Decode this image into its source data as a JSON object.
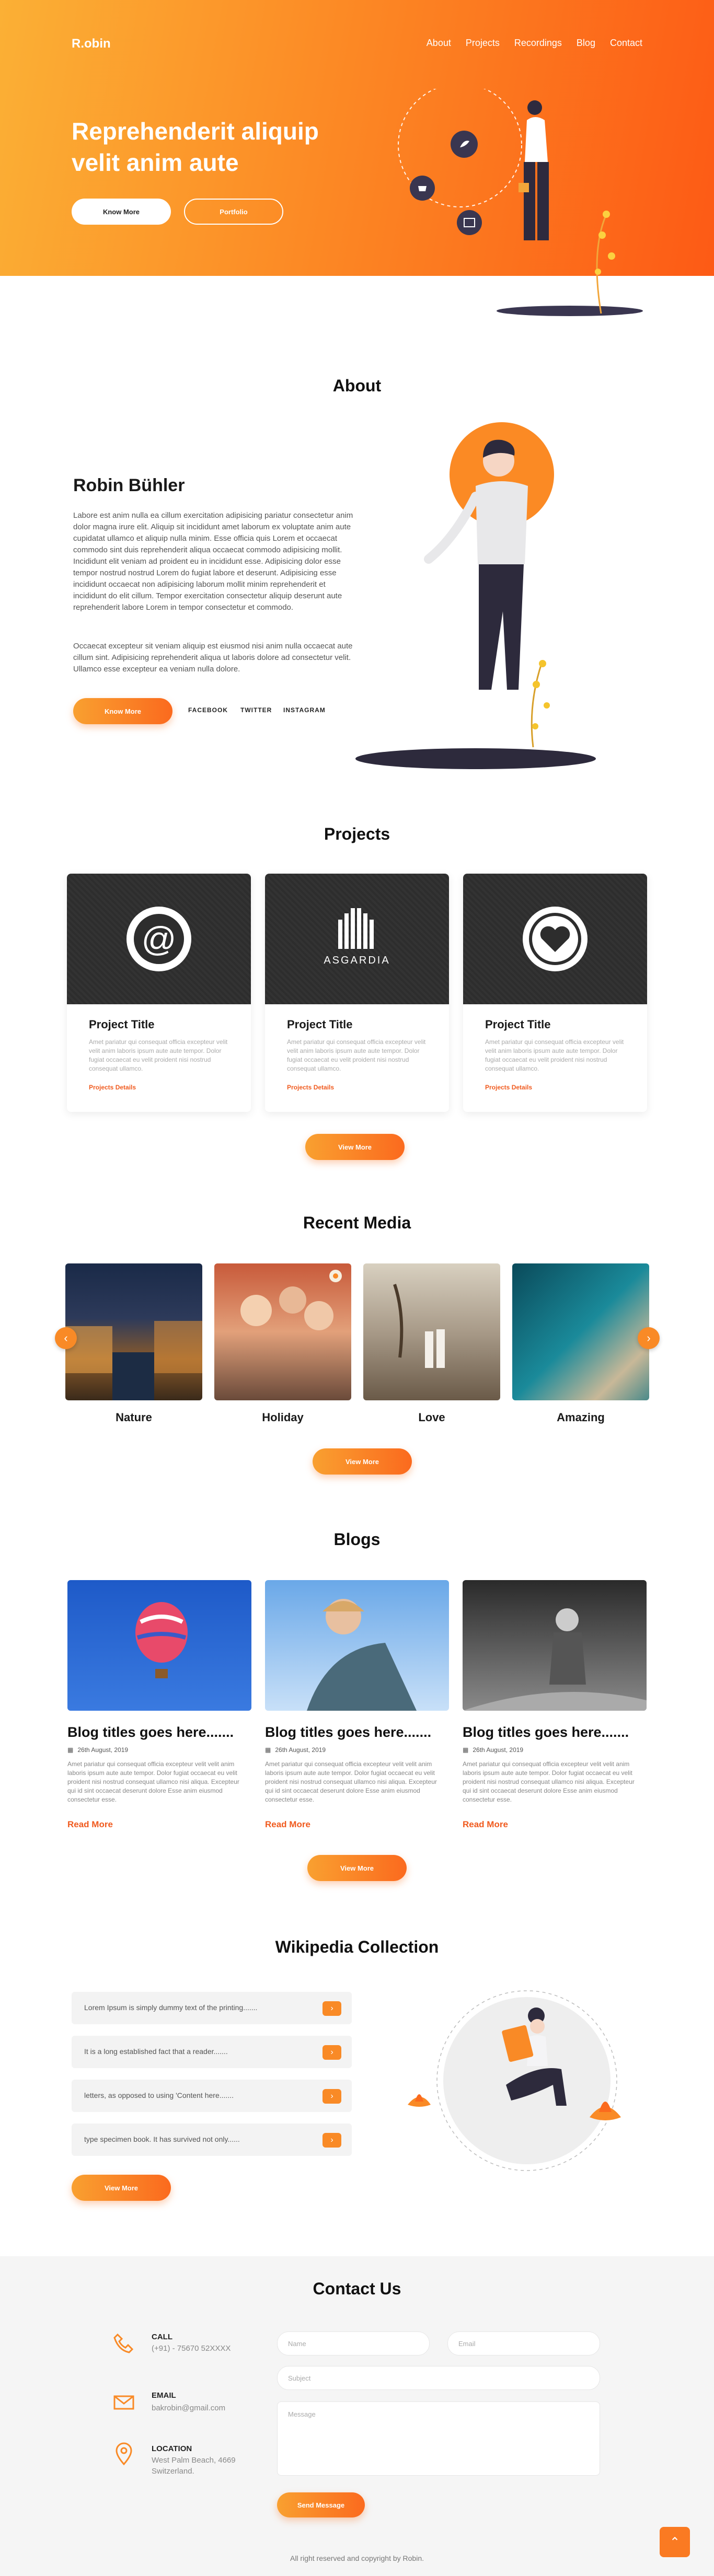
{
  "header": {
    "logo": "R.obin",
    "nav": [
      "About",
      "Projects",
      "Recordings",
      "Blog",
      "Contact"
    ]
  },
  "hero": {
    "title": "Reprehenderit aliquip velit anim aute",
    "btn_primary": "Know More",
    "btn_secondary": "Portfolio"
  },
  "about": {
    "section_title": "About",
    "name": "Robin Bühler",
    "para1": "Labore est anim nulla ea cillum exercitation adipisicing pariatur consectetur anim dolor magna irure elit. Aliquip sit incididunt amet laborum ex voluptate anim aute cupidatat ullamco et aliquip nulla minim. Esse officia quis Lorem et occaecat commodo sint duis reprehenderit aliqua occaecat commodo adipisicing mollit. Incididunt elit veniam ad proident eu in incididunt esse. Adipisicing dolor esse tempor nostrud nostrud Lorem do fugiat labore et deserunt. Adipisicing esse incididunt occaecat non adipisicing laborum mollit minim reprehenderit et incididunt do elit cillum. Tempor exercitation consectetur aliquip deserunt aute reprehenderit labore Lorem in tempor consectetur et commodo.",
    "para2": "Occaecat excepteur sit veniam aliquip est eiusmod nisi anim nulla occaecat aute cillum sint. Adipisicing reprehenderit aliqua ut laboris dolore ad consectetur velit. Ullamco esse excepteur ea veniam nulla dolore.",
    "btn": "Know More",
    "social": [
      "FACEBOOK",
      "TWITTER",
      "INSTAGRAM"
    ]
  },
  "projects": {
    "section_title": "Projects",
    "items": [
      {
        "title": "Project Title",
        "desc": "Amet pariatur qui consequat officia excepteur velit velit anim laboris ipsum aute aute tempor. Dolor fugiat occaecat eu velit proident nisi nostrud consequat ullamco.",
        "link": "Projects Details",
        "logo_text": ""
      },
      {
        "title": "Project Title",
        "desc": "Amet pariatur qui consequat officia excepteur velit velit anim laboris ipsum aute aute tempor. Dolor fugiat occaecat eu velit proident nisi nostrud consequat ullamco.",
        "link": "Projects Details",
        "logo_text": "ASGARDIA"
      },
      {
        "title": "Project Title",
        "desc": "Amet pariatur qui consequat officia excepteur velit velit anim laboris ipsum aute aute tempor. Dolor fugiat occaecat eu velit proident nisi nostrud consequat ullamco.",
        "link": "Projects Details",
        "logo_text": ""
      }
    ],
    "btn": "View More"
  },
  "media": {
    "section_title": "Recent Media",
    "items": [
      "Nature",
      "Holiday",
      "Love",
      "Amazing"
    ],
    "btn": "View More"
  },
  "blogs": {
    "section_title": "Blogs",
    "items": [
      {
        "title": "Blog titles goes here.......",
        "date": "26th August, 2019",
        "desc": "Amet pariatur qui consequat officia excepteur velit velit anim laboris ipsum aute aute tempor. Dolor fugiat occaecat eu velit proident nisi nostrud consequat ullamco nisi aliqua. Excepteur qui id sint occaecat deserunt dolore Esse anim eiusmod consectetur esse.",
        "more": "Read More"
      },
      {
        "title": "Blog titles goes here.......",
        "date": "26th August, 2019",
        "desc": "Amet pariatur qui consequat officia excepteur velit velit anim laboris ipsum aute aute tempor. Dolor fugiat occaecat eu velit proident nisi nostrud consequat ullamco nisi aliqua. Excepteur qui id sint occaecat deserunt dolore Esse anim eiusmod consectetur esse.",
        "more": "Read More"
      },
      {
        "title": "Blog titles goes here.......",
        "date": "26th August, 2019",
        "desc": "Amet pariatur qui consequat officia excepteur velit velit anim laboris ipsum aute aute tempor. Dolor fugiat occaecat eu velit proident nisi nostrud consequat ullamco nisi aliqua. Excepteur qui id sint occaecat deserunt dolore Esse anim eiusmod consectetur esse.",
        "more": "Read More"
      }
    ],
    "btn": "View More"
  },
  "wiki": {
    "section_title": "Wikipedia Collection",
    "items": [
      "Lorem Ipsum is simply dummy text of the printing.......",
      "It is a long established fact that a reader.......",
      "letters, as opposed to using 'Content here.......",
      "type specimen book. It has survived not only......"
    ],
    "btn": "View More"
  },
  "contact": {
    "section_title": "Contact Us",
    "call_label": "CALL",
    "call_value": "(+91) - 75670 52XXXX",
    "email_label": "EMAIL",
    "email_value": "bakrobin@gmail.com",
    "location_label": "LOCATION",
    "location_value": "West Palm Beach, 4669 Switzerland.",
    "name_placeholder": "Name",
    "email_placeholder": "Email",
    "subject_placeholder": "Subject",
    "message_placeholder": "Message",
    "send_btn": "Send Message"
  },
  "footer": {
    "copyright": "All right reserved and copyright by Robin."
  },
  "colors": {
    "accent_start": "#fbb035",
    "accent_end": "#fd5a15",
    "link": "#f05a1e"
  }
}
